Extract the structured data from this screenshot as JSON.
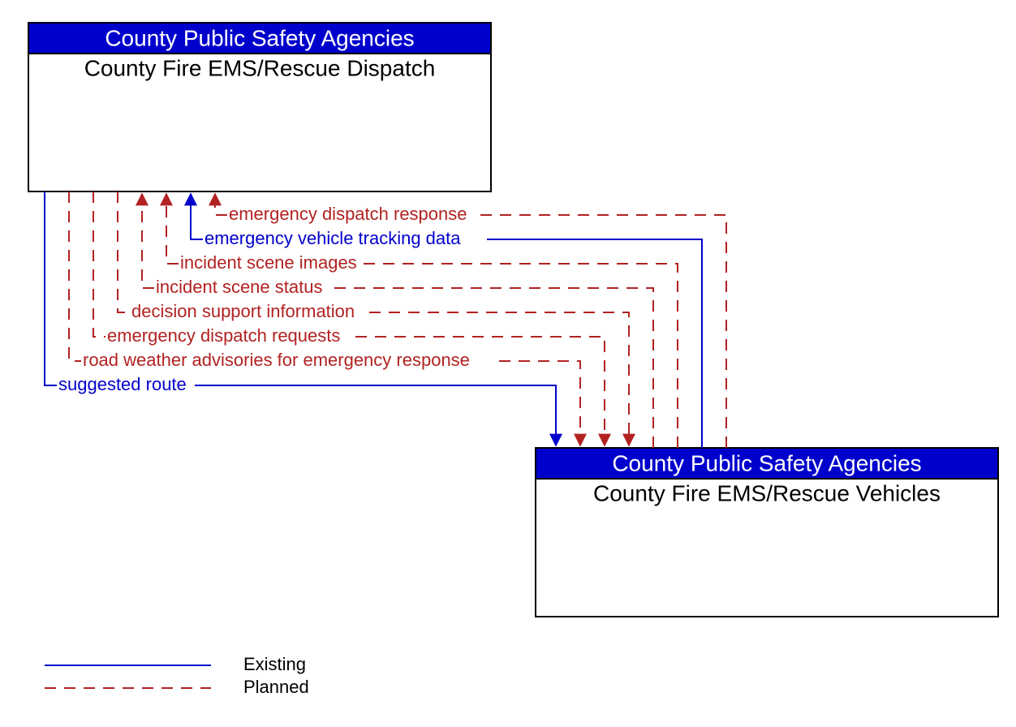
{
  "node_top": {
    "header": "County Public Safety Agencies",
    "body": "County Fire EMS/Rescue Dispatch"
  },
  "node_bottom": {
    "header": "County Public Safety Agencies",
    "body": "County Fire EMS/Rescue Vehicles"
  },
  "flows": {
    "emergency_dispatch_response": "emergency dispatch response",
    "emergency_vehicle_tracking_data": "emergency vehicle tracking data",
    "incident_scene_images": "incident scene images",
    "incident_scene_status": "incident scene status",
    "decision_support_information": "decision support information",
    "emergency_dispatch_requests": "emergency dispatch requests",
    "road_weather_advisories": "road weather advisories for emergency response",
    "suggested_route": "suggested route"
  },
  "legend": {
    "existing": "Existing",
    "planned": "Planned"
  }
}
